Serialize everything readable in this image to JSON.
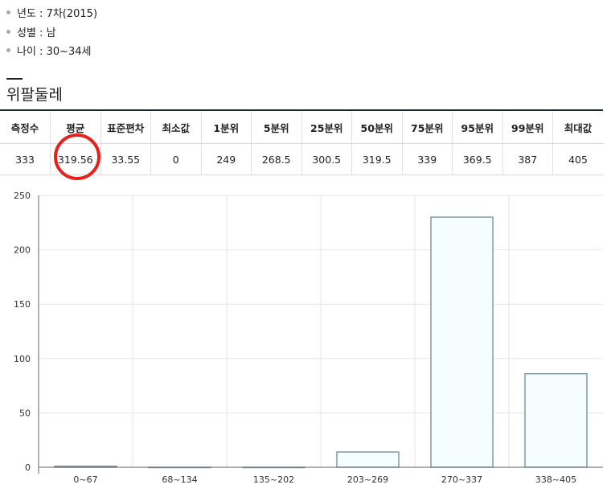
{
  "info": [
    {
      "label": "년도 : 7차(2015)"
    },
    {
      "label": "성별 : 남"
    },
    {
      "label": "나이 : 30~34세"
    }
  ],
  "section_title": "위팔둘레",
  "stats_table": {
    "headers": [
      "측정수",
      "평균",
      "표준편차",
      "최소값",
      "1분위",
      "5분위",
      "25분위",
      "50분위",
      "75분위",
      "95분위",
      "99분위",
      "최대값"
    ],
    "values": [
      "333",
      "319.56",
      "33.55",
      "0",
      "249",
      "268.5",
      "300.5",
      "319.5",
      "339",
      "369.5",
      "387",
      "405"
    ],
    "highlighted_column": "평균"
  },
  "chart_data": {
    "type": "bar",
    "categories": [
      "0~67",
      "68~134",
      "135~202",
      "203~269",
      "270~337",
      "338~405"
    ],
    "values": [
      1,
      0,
      0,
      14,
      230,
      86
    ],
    "ylim": [
      0,
      250
    ],
    "yticks": [
      0,
      50,
      100,
      150,
      200,
      250
    ],
    "grid": true,
    "colors": {
      "bar_fill": "#f5fdff",
      "bar_stroke": "#7f9aa4",
      "grid": "#e6e6e6",
      "axis": "#666666",
      "highlight": "#e3221c"
    }
  }
}
